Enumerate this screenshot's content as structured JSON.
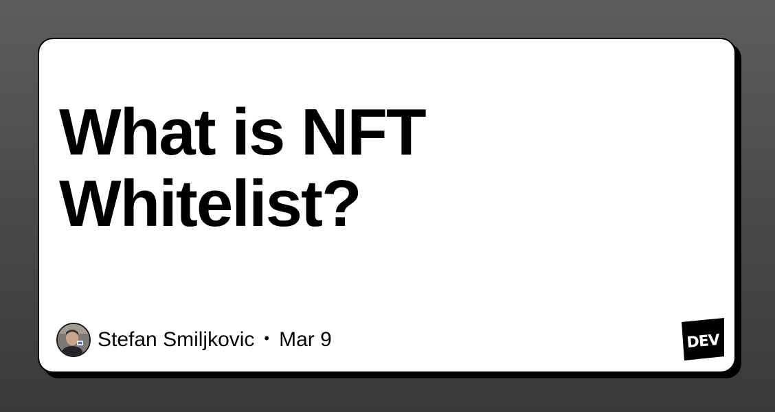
{
  "article": {
    "title_line1": "What is NFT",
    "title_line2": "Whitelist?",
    "author": "Stefan Smiljkovic",
    "separator": "•",
    "date": "Mar 9"
  },
  "branding": {
    "logo_text": "DEV",
    "logo_icon": "dev-logo-icon"
  },
  "colors": {
    "background_top": "#5d5d5d",
    "background_bottom": "#3a3a3a",
    "card": "#ffffff",
    "border": "#000000",
    "text": "#000000"
  }
}
